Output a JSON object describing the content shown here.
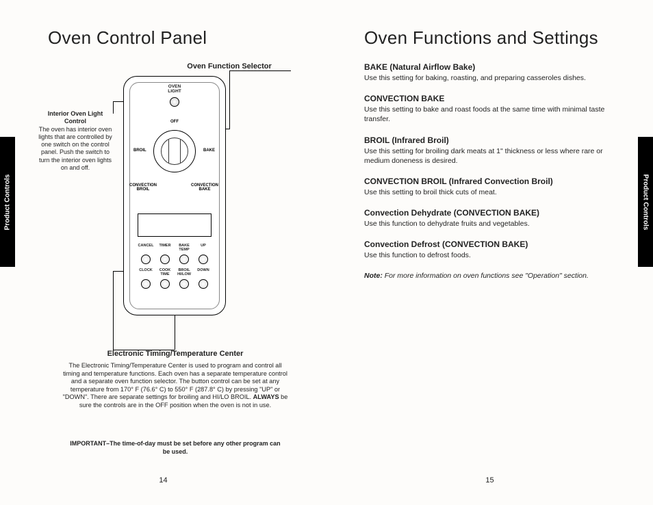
{
  "sideTab": "Product Controls",
  "leftPage": {
    "title": "Oven Control Panel",
    "selectorLabel": "Oven Function Selector",
    "interiorLight": {
      "heading": "Interior Oven Light Control",
      "body": "The oven has interior oven lights that are controlled by one switch on the control panel. Push the switch to turn the interior oven lights on and off."
    },
    "panel": {
      "ovenLightLabel": "OVEN\nLIGHT",
      "dial": {
        "off": "OFF",
        "bake": "BAKE",
        "broil": "BROIL",
        "convBake": "CONVECTION\nBAKE",
        "convBroil": "CONVECTION\nBROIL"
      },
      "buttons": {
        "row1": [
          "CANCEL",
          "TIMER",
          "BAKE\nTEMP",
          "UP"
        ],
        "row2": [
          "CLOCK",
          "COOK\nTIME",
          "BROIL\nHI/LOW",
          "DOWN"
        ]
      }
    },
    "etcLabel": "Electronic Timing/Temperature Center",
    "etcBody": "The Electronic Timing/Temperature Center is used to program and control all timing and temperature functions. Each oven has a separate temperature control and a separate oven function selector. The button control can be set at any temperature from 170° F (76.6° C) to 550° F (287.8° C) by pressing \"UP\" or \"DOWN\". There are separate settings for broiling and HI/LO BROIL. ",
    "etcBodyBold": "ALWAYS",
    "etcBodyAfter": " be sure the controls are in the OFF position when the oven is not in use.",
    "important": "IMPORTANT–The time-of-day must be set before any other program can be used.",
    "pageNumber": "14"
  },
  "rightPage": {
    "title": "Oven Functions and Settings",
    "settings": [
      {
        "heading": "BAKE (Natural Airflow Bake)",
        "body": "Use this setting for baking, roasting, and preparing casseroles dishes."
      },
      {
        "heading": "CONVECTION BAKE",
        "body": "Use this setting to bake and roast foods at the same time with minimal taste transfer."
      },
      {
        "heading": "BROIL (Infrared Broil)",
        "body": "Use this setting for broiling dark meats at 1\" thickness or less where rare or medium doneness is desired."
      },
      {
        "heading": "CONVECTION BROIL (Infrared Convection Broil)",
        "body": "Use this setting to broil thick cuts of meat."
      },
      {
        "heading": "Convection Dehydrate (CONVECTION BAKE)",
        "body": "Use this function to dehydrate fruits and vegetables."
      },
      {
        "heading": "Convection Defrost (CONVECTION BAKE)",
        "body": "Use this function to defrost foods."
      }
    ],
    "noteBold": "Note:",
    "noteItalic": " For more information on oven functions see \"Operation\" section.",
    "pageNumber": "15"
  }
}
